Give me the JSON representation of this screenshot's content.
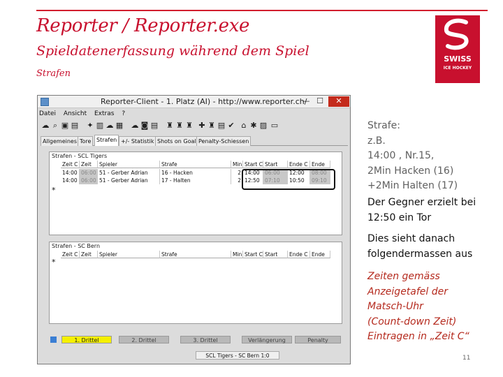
{
  "slide": {
    "title": "Reporter / Reporter.exe",
    "subtitle": "Spieldatenerfassung während dem Spiel",
    "section": "Strafen",
    "page_number": "11",
    "logo": {
      "line1": "SWISS",
      "line2": "ICE HOCKEY",
      "color": "#c8102e"
    }
  },
  "window": {
    "title": "Reporter-Client - 1. Platz (AI) - http://www.reporter.ch/",
    "controls": {
      "minimize": "—",
      "maximize": "☐",
      "close": "✕"
    },
    "menu": [
      "Datei",
      "Ansicht",
      "Extras",
      "?"
    ],
    "tabs": [
      "Allgemeines",
      "Tore",
      "Strafen",
      "+/- Statistik",
      "Shots on Goal",
      "Penalty-Schiessen"
    ],
    "active_tab": "Strafen",
    "home_panel": {
      "title": "Strafen - SCL Tigers",
      "columns": [
        "Zeit C",
        "Zeit",
        "Spieler",
        "Strafe",
        "Min",
        "Start C",
        "Start",
        "Ende C",
        "Ende"
      ],
      "rows": [
        [
          "14:00",
          "06:00",
          "51 - Gerber Adrian",
          "16 - Hacken",
          "2",
          "14:00",
          "06:00",
          "12:00",
          "08:00"
        ],
        [
          "14:00",
          "06:00",
          "51 - Gerber Adrian",
          "17 - Halten",
          "2",
          "12:50",
          "07:10",
          "10:50",
          "09:10"
        ]
      ],
      "new_row_marker": "*"
    },
    "away_panel": {
      "title": "Strafen - SC Bern",
      "columns": [
        "Zeit C",
        "Zeit",
        "Spieler",
        "Strafe",
        "Min",
        "Start C",
        "Start",
        "Ende C",
        "Ende"
      ],
      "new_row_marker": "*"
    },
    "period_tabs": [
      "1. Drittel",
      "2. Drittel",
      "3. Drittel",
      "Verlängerung",
      "Penalty"
    ],
    "active_period": "1. Drittel",
    "score": "SCL Tigers - SC Bern 1:0"
  },
  "notes": {
    "example": [
      "Strafe:",
      "z.B.",
      "14:00 , Nr.15,",
      "2Min Hacken (16)",
      "+2Min Halten (17)"
    ],
    "goal": [
      "Der Gegner erzielt bei",
      "12:50 ein Tor"
    ],
    "result": [
      "Dies sieht danach",
      "folgendermassen aus"
    ],
    "hint": [
      "Zeiten gemäss",
      "Anzeigetafel der",
      "Matsch-Uhr",
      "(Count-down Zeit)",
      "Eintragen in „Zeit C“"
    ]
  }
}
